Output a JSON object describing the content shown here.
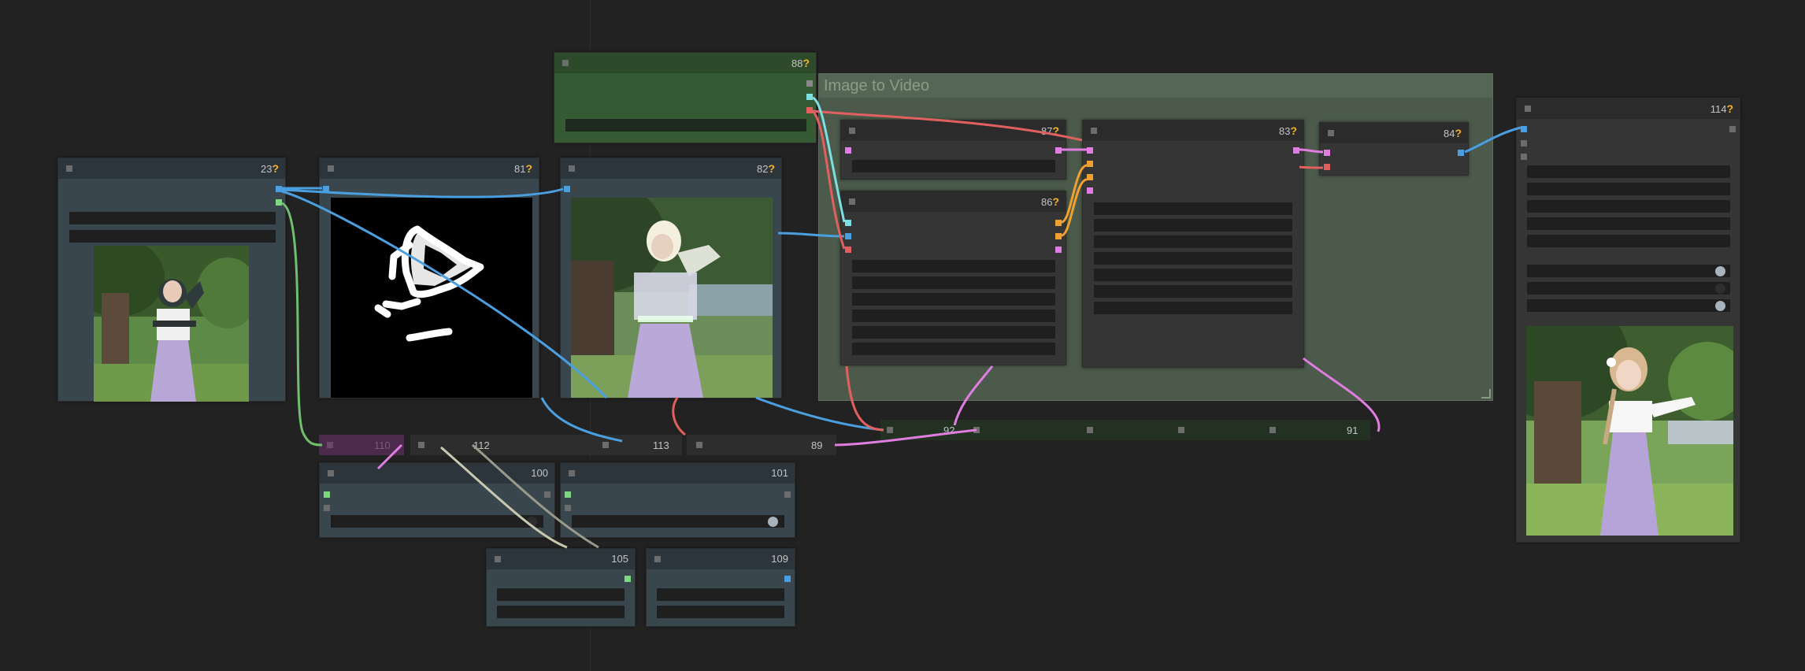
{
  "canvas": {
    "background": "#222222"
  },
  "group": {
    "title": "Image to Video"
  },
  "nodes": {
    "n23": {
      "id": "23",
      "q": "?"
    },
    "n81": {
      "id": "81",
      "q": "?"
    },
    "n82": {
      "id": "82",
      "q": "?"
    },
    "n88": {
      "id": "88",
      "q": "?"
    },
    "n87": {
      "id": "87",
      "q": "?"
    },
    "n86": {
      "id": "86",
      "q": "?"
    },
    "n83": {
      "id": "83",
      "q": "?"
    },
    "n84": {
      "id": "84",
      "q": "?"
    },
    "n114": {
      "id": "114",
      "q": "?"
    },
    "n100": {
      "id": "100"
    },
    "n101": {
      "id": "101"
    },
    "n105": {
      "id": "105"
    },
    "n109": {
      "id": "109"
    }
  },
  "bars": {
    "b110": "110",
    "b112": "112",
    "b113": "113",
    "b89": "89",
    "b92": "92",
    "b91": "91"
  },
  "images": {
    "input_photo": "photo-girl-under-tree",
    "mask": "white-brush-mask-on-black",
    "masked_preview": "photo-girl-masked-overlay",
    "result_photo": "photo-girl-result"
  },
  "slot_colors": {
    "image": "#4a9fe0",
    "mask": "#7dd87d",
    "pink": "#e07de0",
    "orange": "#f0a030",
    "red": "#e06060",
    "gray": "#888888"
  }
}
